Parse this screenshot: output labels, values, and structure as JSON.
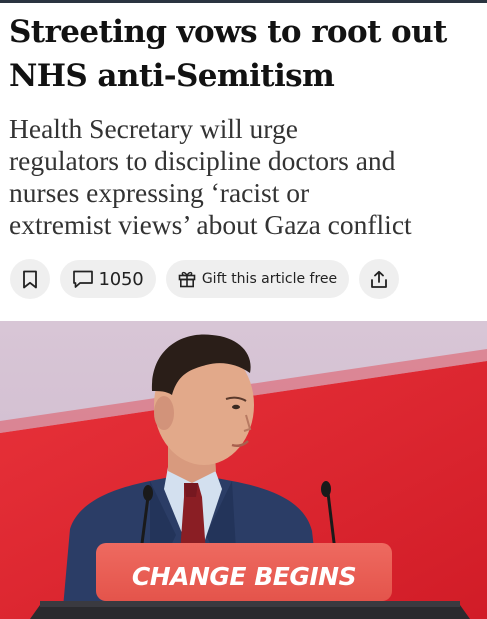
{
  "article": {
    "headline_line1": "Streeting vows to root out",
    "headline_line2": "NHS anti-Semitism",
    "standfirst_line1": "Health Secretary will urge",
    "standfirst_line2": "regulators to discipline doctors and",
    "standfirst_line3": "nurses expressing ‘racist or",
    "standfirst_line4": "extremist views’ about Gaza conflict"
  },
  "actions": {
    "comment_count": "1050",
    "gift_label": "Gift this article free"
  },
  "photo": {
    "podium_sign": "CHANGE BEGINS"
  },
  "colors": {
    "backdrop_red": "#e3262f",
    "podium_sign": "#e8584f",
    "suit": "#2b3d66",
    "tie": "#8a1e24"
  }
}
